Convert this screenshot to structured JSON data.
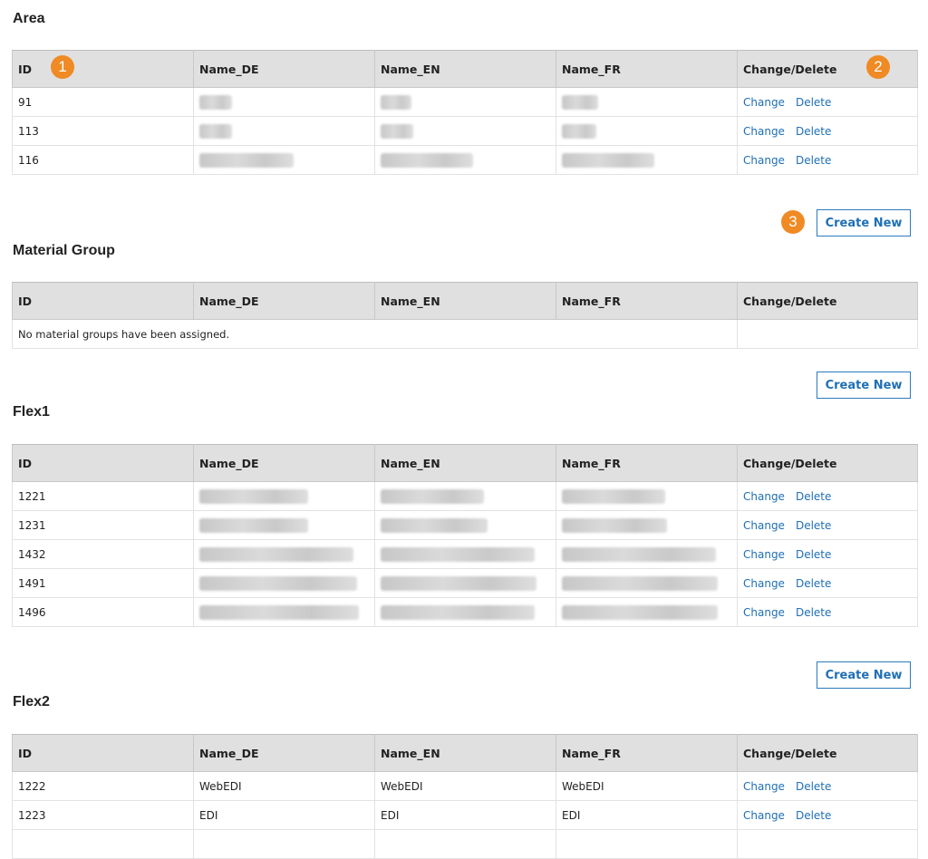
{
  "columns": [
    "ID",
    "Name_DE",
    "Name_EN",
    "Name_FR",
    "Change/Delete"
  ],
  "actions": {
    "change": "Change",
    "delete": "Delete"
  },
  "create_new_label": "Create New",
  "callouts": [
    "1",
    "2",
    "3"
  ],
  "sections": {
    "area": {
      "title": "Area",
      "rows": [
        {
          "id": "91",
          "name_de": "",
          "name_en": "",
          "name_fr": ""
        },
        {
          "id": "113",
          "name_de": "",
          "name_en": "",
          "name_fr": ""
        },
        {
          "id": "116",
          "name_de": "",
          "name_en": "",
          "name_fr": ""
        }
      ]
    },
    "material_group": {
      "title": "Material Group",
      "empty_message": "No material groups have been assigned."
    },
    "flex1": {
      "title": "Flex1",
      "rows": [
        {
          "id": "1221",
          "name_de": "",
          "name_en": "",
          "name_fr": ""
        },
        {
          "id": "1231",
          "name_de": "",
          "name_en": "",
          "name_fr": ""
        },
        {
          "id": "1432",
          "name_de": "",
          "name_en": "",
          "name_fr": ""
        },
        {
          "id": "1491",
          "name_de": "",
          "name_en": "",
          "name_fr": ""
        },
        {
          "id": "1496",
          "name_de": "",
          "name_en": "",
          "name_fr": ""
        }
      ]
    },
    "flex2": {
      "title": "Flex2",
      "rows": [
        {
          "id": "1222",
          "name_de": "WebEDI",
          "name_en": "WebEDI",
          "name_fr": "WebEDI"
        },
        {
          "id": "1223",
          "name_de": "EDI",
          "name_en": "EDI",
          "name_fr": "EDI"
        }
      ]
    }
  },
  "colors": {
    "accent": "#f08a24",
    "link": "#1f6fb5",
    "header_bg": "#e0e0e0"
  }
}
